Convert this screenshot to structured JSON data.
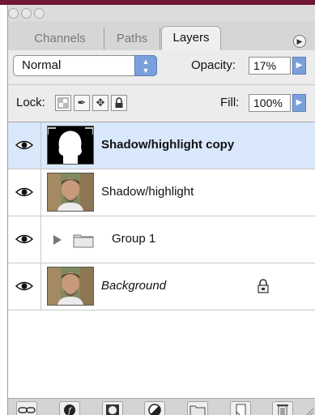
{
  "tabs": [
    {
      "label": "Channels",
      "active": false
    },
    {
      "label": "Paths",
      "active": false
    },
    {
      "label": "Layers",
      "active": true
    }
  ],
  "blend_mode": "Normal",
  "opacity": {
    "label": "Opacity:",
    "value": "17%"
  },
  "lock": {
    "label": "Lock:"
  },
  "fill": {
    "label": "Fill:",
    "value": "100%"
  },
  "layers": [
    {
      "name": "Shadow/highlight copy",
      "selected": true,
      "visible": true,
      "thumbnail": "mask-silhouette"
    },
    {
      "name": "Shadow/highlight",
      "selected": false,
      "visible": true,
      "thumbnail": "portrait-photo"
    },
    {
      "name": "Group 1",
      "selected": false,
      "visible": true,
      "thumbnail": "folder-icon",
      "collapsed": true
    },
    {
      "name": "Background",
      "selected": false,
      "visible": true,
      "thumbnail": "portrait-photo",
      "locked": true
    }
  ],
  "footer_icons": [
    "link-layers-icon",
    "layer-style-icon",
    "layer-mask-icon",
    "adjustment-layer-icon",
    "new-group-icon",
    "new-layer-icon",
    "trash-icon"
  ],
  "colors": {
    "selection": "#d9e8fb",
    "accent_button": "#7aa0dc",
    "window_top_bar": "#6e1736"
  }
}
